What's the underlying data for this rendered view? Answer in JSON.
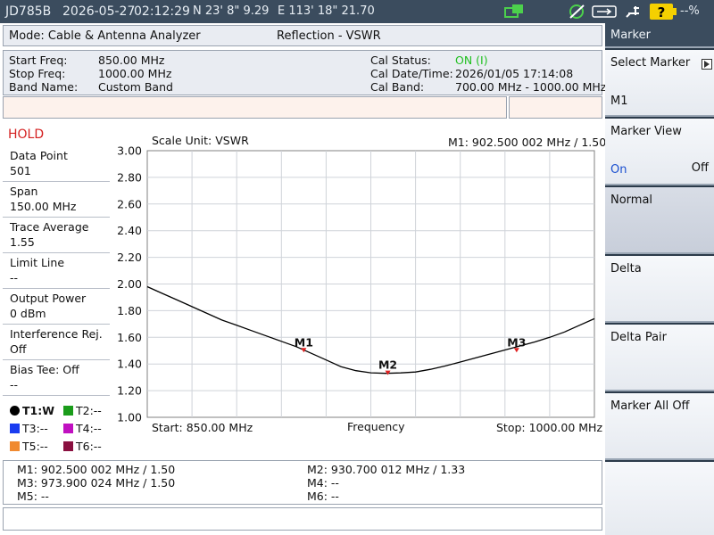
{
  "status_bar": {
    "model": "JD785B",
    "date": "2026-05-27",
    "time": "02:12:29",
    "latitude": "N 23' 8\" 9.29",
    "longitude": "E 113' 18\" 21.70",
    "battery": "--%"
  },
  "header": {
    "mode": "Mode: Cable & Antenna Analyzer",
    "measurement": "Reflection - VSWR"
  },
  "info": {
    "start_freq_label": "Start Freq:",
    "start_freq": "850.00 MHz",
    "stop_freq_label": "Stop Freq:",
    "stop_freq": "1000.00 MHz",
    "band_name_label": "Band Name:",
    "band_name": "Custom Band",
    "cal_status_label": "Cal Status:",
    "cal_status": "ON (I)",
    "cal_datetime_label": "Cal Date/Time:",
    "cal_datetime": "2026/01/05 17:14:08",
    "cal_band_label": "Cal Band:",
    "cal_band": "700.00 MHz - 1000.00 MHz"
  },
  "side_panel": {
    "hold": "HOLD",
    "items": [
      {
        "label": "Data Point",
        "value": "501"
      },
      {
        "label": "Span",
        "value": "150.00 MHz"
      },
      {
        "label": "Trace Average",
        "value": "1.55"
      },
      {
        "label": "Limit Line",
        "value": "--"
      },
      {
        "label": "Output Power",
        "value": "0 dBm"
      },
      {
        "label": "Interference Rej.",
        "value": "Off"
      },
      {
        "label": "Bias Tee: Off",
        "value": "--"
      }
    ],
    "traces": [
      "T1:W",
      "T2:--",
      "T3:--",
      "T4:--",
      "T5:--",
      "T6:--"
    ]
  },
  "chart_header": {
    "scale_unit": "Scale Unit: VSWR",
    "marker_readout": "M1:  902.500 002 MHz / 1.50"
  },
  "chart_footer": {
    "start": "Start: 850.00 MHz",
    "xlabel": "Frequency",
    "stop": "Stop: 1000.00 MHz"
  },
  "chart_data": {
    "type": "line",
    "ylim": [
      1.0,
      3.0
    ],
    "xlim": [
      850.0,
      1000.0
    ],
    "y_ticks": [
      "3.00",
      "2.80",
      "2.60",
      "2.40",
      "2.20",
      "2.00",
      "1.80",
      "1.60",
      "1.40",
      "1.20",
      "1.00"
    ],
    "grid": true,
    "x": [
      850,
      855,
      860,
      865,
      870,
      875,
      880,
      885,
      890,
      895,
      900,
      905,
      910,
      915,
      920,
      925,
      930,
      935,
      940,
      945,
      950,
      955,
      960,
      965,
      970,
      975,
      980,
      985,
      990,
      995,
      1000
    ],
    "values": [
      1.98,
      1.93,
      1.88,
      1.83,
      1.78,
      1.73,
      1.69,
      1.65,
      1.61,
      1.57,
      1.53,
      1.48,
      1.43,
      1.38,
      1.35,
      1.334,
      1.33,
      1.333,
      1.34,
      1.36,
      1.385,
      1.415,
      1.445,
      1.475,
      1.505,
      1.535,
      1.565,
      1.6,
      1.64,
      1.69,
      1.74
    ],
    "markers": [
      {
        "label": "M1",
        "x": 902.5,
        "y": 1.5
      },
      {
        "label": "M2",
        "x": 930.7,
        "y": 1.33
      },
      {
        "label": "M3",
        "x": 973.9,
        "y": 1.5
      }
    ],
    "trace_color": "#000000",
    "marker_color": "#e02020"
  },
  "marker_table": [
    "M1: 902.500 002 MHz / 1.50",
    "M2: 930.700 012 MHz / 1.33",
    "M3: 973.900 024 MHz / 1.50",
    "M4: --",
    "M5: --",
    "M6: --"
  ],
  "softkeys": {
    "title": "Marker",
    "select_marker": "Select Marker",
    "select_marker_value": "M1",
    "marker_view": "Marker View",
    "marker_view_on": "On",
    "marker_view_off": "Off",
    "normal": "Normal",
    "delta": "Delta",
    "delta_pair": "Delta Pair",
    "marker_all_off": "Marker All Off"
  },
  "colors": {
    "hold": "#d42020",
    "cal_on": "#22c022",
    "t2": "#1a9c1a",
    "t3": "#1a3cf0",
    "t4": "#c010c0",
    "t5": "#f08a30",
    "t6": "#8a1040"
  }
}
